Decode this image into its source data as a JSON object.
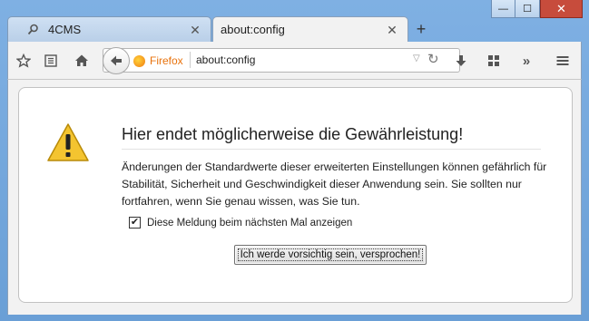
{
  "window": {
    "minimize_label": "—",
    "maximize_label": "☐",
    "close_label": "✕"
  },
  "tabs": [
    {
      "label": "4CMS",
      "icon": "search-icon",
      "active": false
    },
    {
      "label": "about:config",
      "icon": "",
      "active": true
    }
  ],
  "newtab_label": "+",
  "toolbar": {
    "identity_label": "Firefox",
    "url": "about:config"
  },
  "warning": {
    "title": "Hier endet möglicherweise die Gewährleistung!",
    "message": "Änderungen der Standardwerte dieser erweiterten Einstellungen können gefährlich für Stabilität, Sicherheit und Geschwindigkeit dieser Anwendung sein. Sie sollten nur fortfahren, wenn Sie genau wissen, was Sie tun.",
    "checkbox_label": "Diese Meldung beim nächsten Mal anzeigen",
    "checkbox_checked": true,
    "button_label": "Ich werde vorsichtig sein, versprochen!"
  },
  "colors": {
    "frame": "#6b9fd6",
    "identity": "#e8720c",
    "warning_yellow": "#f4c430"
  }
}
